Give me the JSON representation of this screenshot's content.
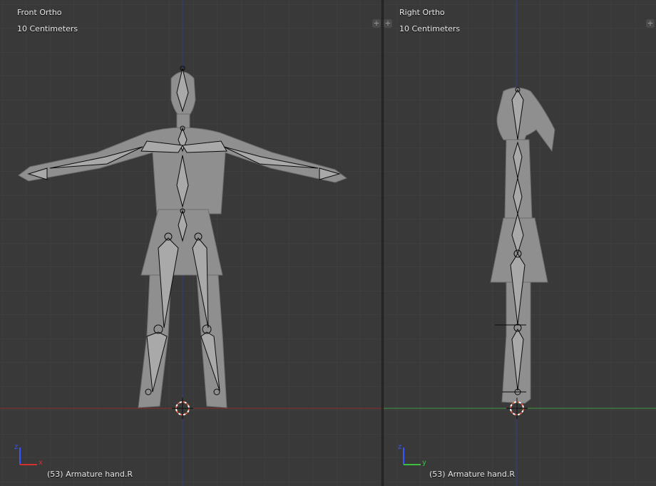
{
  "viewports": [
    {
      "view_name": "Front Ortho",
      "scale_label": "10 Centimeters",
      "status": "(53) Armature hand.R",
      "axes": {
        "horizontal": "x",
        "vertical": "z"
      },
      "horizon_color": "#8e3030",
      "vertical_axis_color": "#2e3a8a"
    },
    {
      "view_name": "Right Ortho",
      "scale_label": "10 Centimeters",
      "status": "(53) Armature hand.R",
      "axes": {
        "horizontal": "y",
        "vertical": "z"
      },
      "horizon_color": "#3f9a3f",
      "vertical_axis_color": "#2e3a8a"
    }
  ],
  "corner_widget_icon": "plus-icon",
  "colors": {
    "background": "#393939",
    "grid": "#444444",
    "mesh": "#8f8f8f",
    "bones": "#0a0a0a",
    "cursor": "#e05a3a"
  }
}
